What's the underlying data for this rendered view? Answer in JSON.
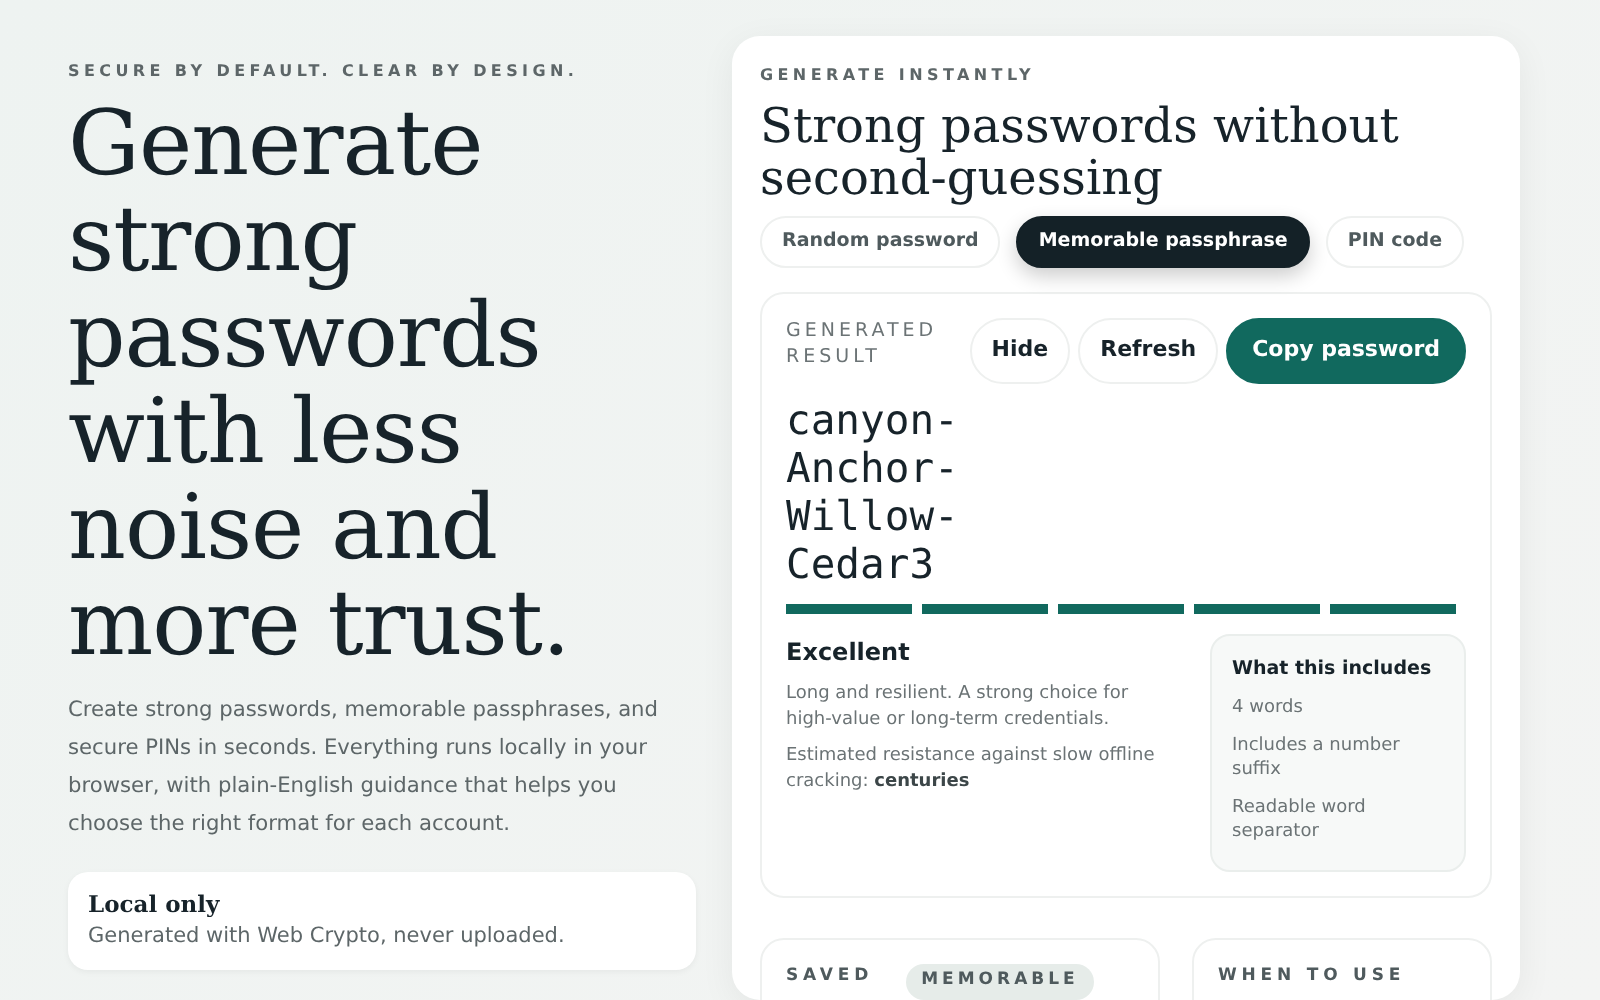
{
  "hero": {
    "eyebrow": "SECURE BY DEFAULT. CLEAR BY DESIGN.",
    "title": "Generate strong passwords with less noise and more trust.",
    "intro": "Create strong passwords, memorable passphrases, and secure PINs in seconds. Everything runs locally in your browser, with plain-English guidance that helps you choose the right format for each account.",
    "features": [
      {
        "title": "Local only",
        "text": "Generated with Web Crypto, never uploaded."
      }
    ]
  },
  "generator": {
    "eyebrow": "GENERATE INSTANTLY",
    "title": "Strong passwords without second-guessing",
    "tabs": [
      {
        "label": "Random password",
        "selected": false
      },
      {
        "label": "Memorable passphrase",
        "selected": true
      },
      {
        "label": "PIN code",
        "selected": false
      }
    ],
    "result": {
      "label": "GENERATED RESULT",
      "buttons": [
        {
          "label": "Hide",
          "kind": "plain"
        },
        {
          "label": "Refresh",
          "kind": "plain"
        },
        {
          "label": "Copy password",
          "kind": "primary"
        }
      ],
      "password": "canyon-Anchor-Willow-Cedar3",
      "level": 1,
      "rating": "Excellent",
      "summary": "Long and resilient. A strong choice for high-value or long-term credentials.",
      "estimate": "Estimated resistance against slow offline cracking: **centuries**",
      "includes": {
        "title": "What this includes",
        "items": [
          "4 words",
          "Includes a number suffix",
          "Readable word separator"
        ]
      }
    }
  },
  "bottom_cards": [
    {
      "label": "SAVED",
      "badge": "MEMORABLE"
    },
    {
      "label": "WHEN TO USE"
    }
  ]
}
